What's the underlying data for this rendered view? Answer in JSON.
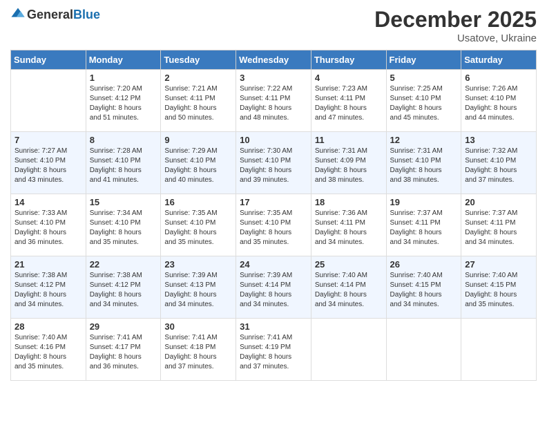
{
  "logo": {
    "general": "General",
    "blue": "Blue"
  },
  "title": "December 2025",
  "location": "Usatove, Ukraine",
  "days_of_week": [
    "Sunday",
    "Monday",
    "Tuesday",
    "Wednesday",
    "Thursday",
    "Friday",
    "Saturday"
  ],
  "weeks": [
    [
      {
        "day": "",
        "content": ""
      },
      {
        "day": "1",
        "content": "Sunrise: 7:20 AM\nSunset: 4:12 PM\nDaylight: 8 hours\nand 51 minutes."
      },
      {
        "day": "2",
        "content": "Sunrise: 7:21 AM\nSunset: 4:11 PM\nDaylight: 8 hours\nand 50 minutes."
      },
      {
        "day": "3",
        "content": "Sunrise: 7:22 AM\nSunset: 4:11 PM\nDaylight: 8 hours\nand 48 minutes."
      },
      {
        "day": "4",
        "content": "Sunrise: 7:23 AM\nSunset: 4:11 PM\nDaylight: 8 hours\nand 47 minutes."
      },
      {
        "day": "5",
        "content": "Sunrise: 7:25 AM\nSunset: 4:10 PM\nDaylight: 8 hours\nand 45 minutes."
      },
      {
        "day": "6",
        "content": "Sunrise: 7:26 AM\nSunset: 4:10 PM\nDaylight: 8 hours\nand 44 minutes."
      }
    ],
    [
      {
        "day": "7",
        "content": "Sunrise: 7:27 AM\nSunset: 4:10 PM\nDaylight: 8 hours\nand 43 minutes."
      },
      {
        "day": "8",
        "content": "Sunrise: 7:28 AM\nSunset: 4:10 PM\nDaylight: 8 hours\nand 41 minutes."
      },
      {
        "day": "9",
        "content": "Sunrise: 7:29 AM\nSunset: 4:10 PM\nDaylight: 8 hours\nand 40 minutes."
      },
      {
        "day": "10",
        "content": "Sunrise: 7:30 AM\nSunset: 4:10 PM\nDaylight: 8 hours\nand 39 minutes."
      },
      {
        "day": "11",
        "content": "Sunrise: 7:31 AM\nSunset: 4:09 PM\nDaylight: 8 hours\nand 38 minutes."
      },
      {
        "day": "12",
        "content": "Sunrise: 7:31 AM\nSunset: 4:10 PM\nDaylight: 8 hours\nand 38 minutes."
      },
      {
        "day": "13",
        "content": "Sunrise: 7:32 AM\nSunset: 4:10 PM\nDaylight: 8 hours\nand 37 minutes."
      }
    ],
    [
      {
        "day": "14",
        "content": "Sunrise: 7:33 AM\nSunset: 4:10 PM\nDaylight: 8 hours\nand 36 minutes."
      },
      {
        "day": "15",
        "content": "Sunrise: 7:34 AM\nSunset: 4:10 PM\nDaylight: 8 hours\nand 35 minutes."
      },
      {
        "day": "16",
        "content": "Sunrise: 7:35 AM\nSunset: 4:10 PM\nDaylight: 8 hours\nand 35 minutes."
      },
      {
        "day": "17",
        "content": "Sunrise: 7:35 AM\nSunset: 4:10 PM\nDaylight: 8 hours\nand 35 minutes."
      },
      {
        "day": "18",
        "content": "Sunrise: 7:36 AM\nSunset: 4:11 PM\nDaylight: 8 hours\nand 34 minutes."
      },
      {
        "day": "19",
        "content": "Sunrise: 7:37 AM\nSunset: 4:11 PM\nDaylight: 8 hours\nand 34 minutes."
      },
      {
        "day": "20",
        "content": "Sunrise: 7:37 AM\nSunset: 4:11 PM\nDaylight: 8 hours\nand 34 minutes."
      }
    ],
    [
      {
        "day": "21",
        "content": "Sunrise: 7:38 AM\nSunset: 4:12 PM\nDaylight: 8 hours\nand 34 minutes."
      },
      {
        "day": "22",
        "content": "Sunrise: 7:38 AM\nSunset: 4:12 PM\nDaylight: 8 hours\nand 34 minutes."
      },
      {
        "day": "23",
        "content": "Sunrise: 7:39 AM\nSunset: 4:13 PM\nDaylight: 8 hours\nand 34 minutes."
      },
      {
        "day": "24",
        "content": "Sunrise: 7:39 AM\nSunset: 4:14 PM\nDaylight: 8 hours\nand 34 minutes."
      },
      {
        "day": "25",
        "content": "Sunrise: 7:40 AM\nSunset: 4:14 PM\nDaylight: 8 hours\nand 34 minutes."
      },
      {
        "day": "26",
        "content": "Sunrise: 7:40 AM\nSunset: 4:15 PM\nDaylight: 8 hours\nand 34 minutes."
      },
      {
        "day": "27",
        "content": "Sunrise: 7:40 AM\nSunset: 4:15 PM\nDaylight: 8 hours\nand 35 minutes."
      }
    ],
    [
      {
        "day": "28",
        "content": "Sunrise: 7:40 AM\nSunset: 4:16 PM\nDaylight: 8 hours\nand 35 minutes."
      },
      {
        "day": "29",
        "content": "Sunrise: 7:41 AM\nSunset: 4:17 PM\nDaylight: 8 hours\nand 36 minutes."
      },
      {
        "day": "30",
        "content": "Sunrise: 7:41 AM\nSunset: 4:18 PM\nDaylight: 8 hours\nand 37 minutes."
      },
      {
        "day": "31",
        "content": "Sunrise: 7:41 AM\nSunset: 4:19 PM\nDaylight: 8 hours\nand 37 minutes."
      },
      {
        "day": "",
        "content": ""
      },
      {
        "day": "",
        "content": ""
      },
      {
        "day": "",
        "content": ""
      }
    ]
  ]
}
